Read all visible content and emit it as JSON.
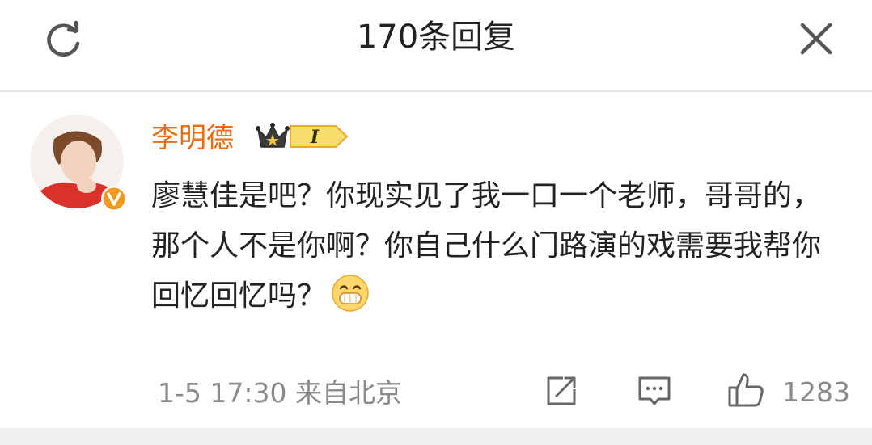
{
  "header": {
    "title": "170条回复",
    "refresh_icon": "refresh-icon",
    "close_icon": "close-icon"
  },
  "comment": {
    "author": "李明德",
    "verified_badge_icon": "v-badge-icon",
    "vip_badge": {
      "icon": "crown-icon",
      "level": "I"
    },
    "text": "廖慧佳是吧？你现实见了我一口一个老师，哥哥的，那个人不是你啊？你自己什么门路演的戏需要我帮你回忆回忆吗？",
    "emoji_icon": "grin-emoji-icon",
    "meta": "1-5 17:30  来自北京",
    "actions": {
      "share_icon": "share-icon",
      "reply_icon": "reply-icon",
      "like_icon": "thumbs-up-icon",
      "like_count": "1283"
    }
  },
  "colors": {
    "username": "#e86b16",
    "text": "#222222",
    "meta": "#8a8a8a",
    "badge_orange": "#f39a1e",
    "divider": "#e6e6e6"
  }
}
